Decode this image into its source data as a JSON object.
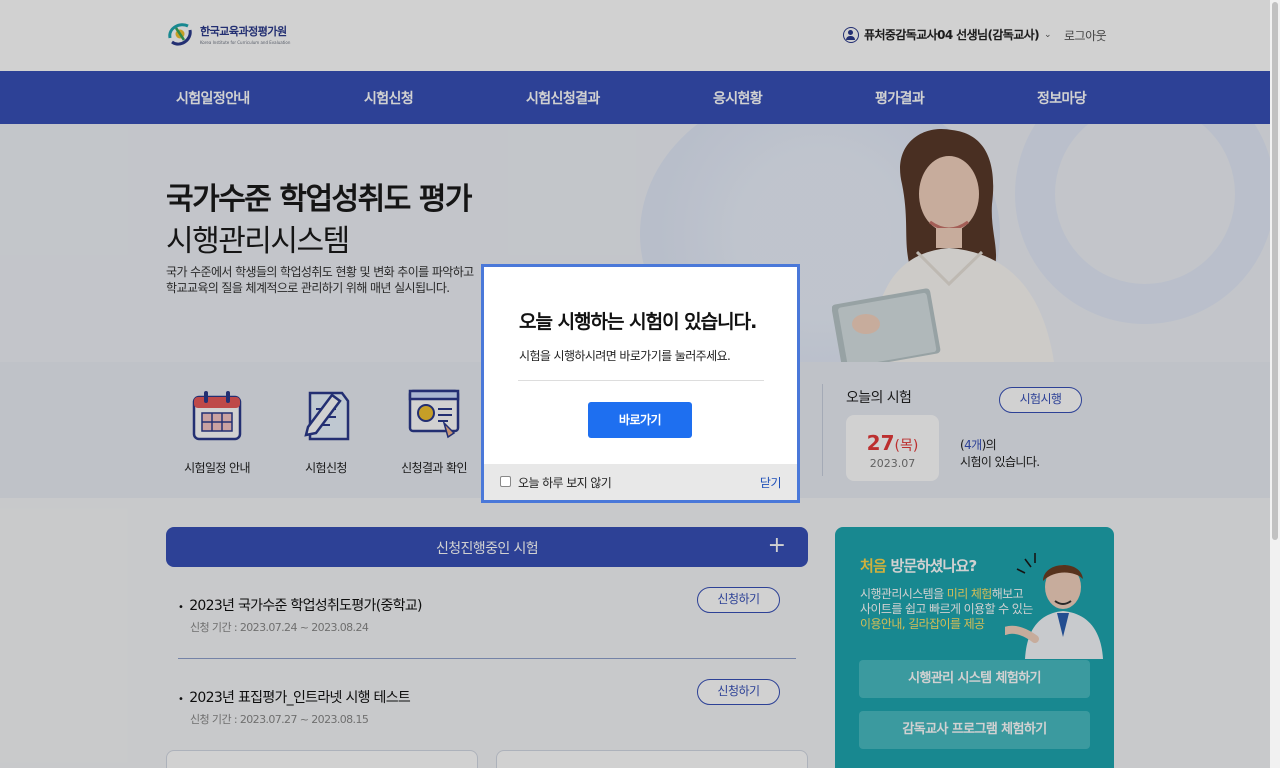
{
  "header": {
    "logo_ko": "한국교육과정평가원",
    "logo_en": "Korea Institute for Curriculum and Evaluation",
    "user_name": "퓨처중감독교사04 선생님(감독교사)",
    "logout": "로그아웃"
  },
  "nav": {
    "items": [
      "시험일정안내",
      "시험신청",
      "시험신청결과",
      "응시현황",
      "평가결과",
      "정보마당"
    ]
  },
  "hero": {
    "title": "국가수준 학업성취도 평가",
    "subtitle": "시행관리시스템",
    "desc_line1": "국가 수준에서 학생들의 학업성취도 현황 및 변화 추이를 파악하고",
    "desc_line2": "학교교육의 질을 체계적으로 관리하기 위해 매년 실시됩니다."
  },
  "quick_links": [
    "시험일정 안내",
    "시험신청",
    "신청결과 확인"
  ],
  "today": {
    "title": "오늘의 시험",
    "button": "시험시행",
    "day": "27",
    "weekday": "(목)",
    "year_month": "2023.07",
    "count": "4개",
    "count_prefix": "(",
    "count_suffix": ")의",
    "message": "시험이 있습니다."
  },
  "applying": {
    "title": "신청진행중인 시험",
    "plus": "+",
    "exams": [
      {
        "title": "2023년 국가수준 학업성취도평가(중학교)",
        "period": "신청 기간 : 2023.07.24 ~ 2023.08.24",
        "button": "신청하기"
      },
      {
        "title": "2023년 표집평가_인트라넷 시행 테스트",
        "period": "신청 기간 : 2023.07.27 ~ 2023.08.15",
        "button": "신청하기"
      }
    ]
  },
  "promo": {
    "title_first": "처음",
    "title_rest": " 방문하셨나요?",
    "desc_line1_a": "시행관리시스템을 ",
    "desc_line1_b": "미리 체험",
    "desc_line1_c": "해보고",
    "desc_line2": "사이트를 쉽고 빠르게 이용할 수 있는",
    "desc_line3": "이용안내, 길라잡이를 제공",
    "btn1": "시행관리 시스템 체험하기",
    "btn2": "감독교사 프로그램 체험하기"
  },
  "modal": {
    "title": "오늘 시행하는 시험이 있습니다.",
    "message": "시험을 시행하시려면 바로가기를 눌러주세요.",
    "go_button": "바로가기",
    "checkbox_label": "오늘 하루 보지 않기",
    "checkbox_checked": false,
    "close": "닫기"
  },
  "colors": {
    "primary": "#3750b8",
    "modal_button": "#1e6ff0",
    "modal_border": "#4a78d9",
    "promo_bg": "#1ea7b0",
    "date_red": "#e63a3a"
  },
  "icons": [
    "user-icon",
    "chevron-down-icon",
    "calendar-icon",
    "document-pen-icon",
    "chart-report-icon",
    "plus-icon",
    "checkbox-icon"
  ]
}
